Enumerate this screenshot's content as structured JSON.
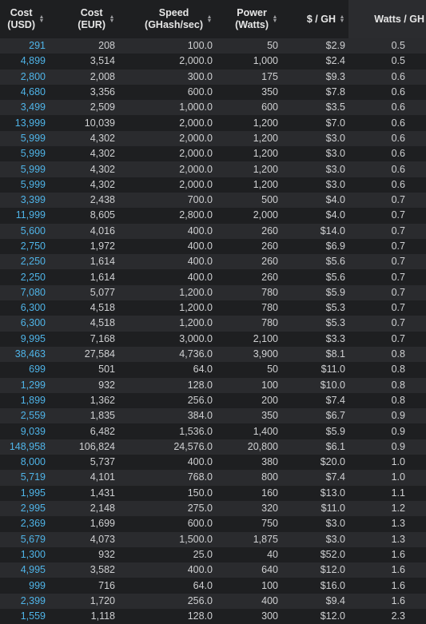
{
  "headers": [
    {
      "line1": "Cost",
      "line2": "(USD)"
    },
    {
      "line1": "Cost",
      "line2": "(EUR)"
    },
    {
      "line1": "Speed",
      "line2": "(GHash/sec)"
    },
    {
      "line1": "Power",
      "line2": "(Watts)"
    },
    {
      "line1": "$ / GH",
      "line2": ""
    },
    {
      "line1": "Watts / GH",
      "line2": ""
    }
  ],
  "rows": [
    [
      "291",
      "208",
      "100.0",
      "50",
      "$2.9",
      "0.5"
    ],
    [
      "4,899",
      "3,514",
      "2,000.0",
      "1,000",
      "$2.4",
      "0.5"
    ],
    [
      "2,800",
      "2,008",
      "300.0",
      "175",
      "$9.3",
      "0.6"
    ],
    [
      "4,680",
      "3,356",
      "600.0",
      "350",
      "$7.8",
      "0.6"
    ],
    [
      "3,499",
      "2,509",
      "1,000.0",
      "600",
      "$3.5",
      "0.6"
    ],
    [
      "13,999",
      "10,039",
      "2,000.0",
      "1,200",
      "$7.0",
      "0.6"
    ],
    [
      "5,999",
      "4,302",
      "2,000.0",
      "1,200",
      "$3.0",
      "0.6"
    ],
    [
      "5,999",
      "4,302",
      "2,000.0",
      "1,200",
      "$3.0",
      "0.6"
    ],
    [
      "5,999",
      "4,302",
      "2,000.0",
      "1,200",
      "$3.0",
      "0.6"
    ],
    [
      "5,999",
      "4,302",
      "2,000.0",
      "1,200",
      "$3.0",
      "0.6"
    ],
    [
      "3,399",
      "2,438",
      "700.0",
      "500",
      "$4.0",
      "0.7"
    ],
    [
      "11,999",
      "8,605",
      "2,800.0",
      "2,000",
      "$4.0",
      "0.7"
    ],
    [
      "5,600",
      "4,016",
      "400.0",
      "260",
      "$14.0",
      "0.7"
    ],
    [
      "2,750",
      "1,972",
      "400.0",
      "260",
      "$6.9",
      "0.7"
    ],
    [
      "2,250",
      "1,614",
      "400.0",
      "260",
      "$5.6",
      "0.7"
    ],
    [
      "2,250",
      "1,614",
      "400.0",
      "260",
      "$5.6",
      "0.7"
    ],
    [
      "7,080",
      "5,077",
      "1,200.0",
      "780",
      "$5.9",
      "0.7"
    ],
    [
      "6,300",
      "4,518",
      "1,200.0",
      "780",
      "$5.3",
      "0.7"
    ],
    [
      "6,300",
      "4,518",
      "1,200.0",
      "780",
      "$5.3",
      "0.7"
    ],
    [
      "9,995",
      "7,168",
      "3,000.0",
      "2,100",
      "$3.3",
      "0.7"
    ],
    [
      "38,463",
      "27,584",
      "4,736.0",
      "3,900",
      "$8.1",
      "0.8"
    ],
    [
      "699",
      "501",
      "64.0",
      "50",
      "$11.0",
      "0.8"
    ],
    [
      "1,299",
      "932",
      "128.0",
      "100",
      "$10.0",
      "0.8"
    ],
    [
      "1,899",
      "1,362",
      "256.0",
      "200",
      "$7.4",
      "0.8"
    ],
    [
      "2,559",
      "1,835",
      "384.0",
      "350",
      "$6.7",
      "0.9"
    ],
    [
      "9,039",
      "6,482",
      "1,536.0",
      "1,400",
      "$5.9",
      "0.9"
    ],
    [
      "148,958",
      "106,824",
      "24,576.0",
      "20,800",
      "$6.1",
      "0.9"
    ],
    [
      "8,000",
      "5,737",
      "400.0",
      "380",
      "$20.0",
      "1.0"
    ],
    [
      "5,719",
      "4,101",
      "768.0",
      "800",
      "$7.4",
      "1.0"
    ],
    [
      "1,995",
      "1,431",
      "150.0",
      "160",
      "$13.0",
      "1.1"
    ],
    [
      "2,995",
      "2,148",
      "275.0",
      "320",
      "$11.0",
      "1.2"
    ],
    [
      "2,369",
      "1,699",
      "600.0",
      "750",
      "$3.0",
      "1.3"
    ],
    [
      "5,679",
      "4,073",
      "1,500.0",
      "1,875",
      "$3.0",
      "1.3"
    ],
    [
      "1,300",
      "932",
      "25.0",
      "40",
      "$52.0",
      "1.6"
    ],
    [
      "4,995",
      "3,582",
      "400.0",
      "640",
      "$12.0",
      "1.6"
    ],
    [
      "999",
      "716",
      "64.0",
      "100",
      "$16.0",
      "1.6"
    ],
    [
      "2,399",
      "1,720",
      "256.0",
      "400",
      "$9.4",
      "1.6"
    ],
    [
      "1,559",
      "1,118",
      "128.0",
      "300",
      "$12.0",
      "2.3"
    ]
  ],
  "colors": {
    "background": "#1e1f21",
    "stripe": "#2a2b2e",
    "usd_text": "#4fb4e8",
    "text": "#cfd0d2",
    "sorted_header": "#2b2c2f"
  },
  "icons": {
    "sort": "sort-arrows-icon"
  }
}
